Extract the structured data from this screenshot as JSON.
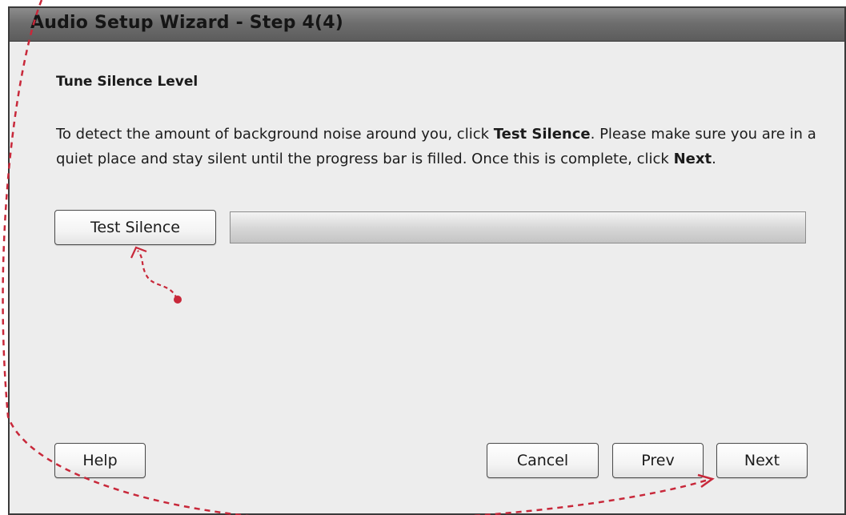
{
  "window": {
    "title": "Audio Setup Wizard - Step 4(4)"
  },
  "content": {
    "heading": "Tune Silence Level",
    "instructions": {
      "line1_pre": "To detect the amount of background noise around you, click ",
      "line1_bold": "Test Silence",
      "line1_post": ". Please make sure you are in a quiet place and stay silent until the progress bar is filled. Once this is complete, click ",
      "line2_bold": "Next",
      "line2_post": "."
    },
    "test_button_label": "Test Silence",
    "progress": {
      "fraction": 0
    }
  },
  "footer": {
    "help_label": "Help",
    "cancel_label": "Cancel",
    "prev_label": "Prev",
    "next_label": "Next"
  },
  "annotation": {
    "color": "#c8283a"
  }
}
